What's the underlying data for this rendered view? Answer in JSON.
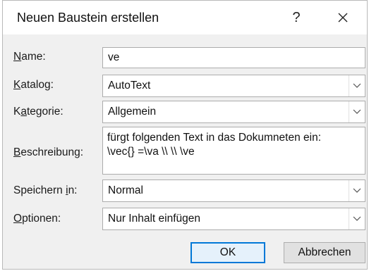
{
  "dialog": {
    "title": "Neuen Baustein erstellen",
    "help_label": "?",
    "close_icon": "close-icon"
  },
  "form": {
    "name": {
      "label_accel": "N",
      "label_rest": "ame:",
      "value": "ve"
    },
    "katalog": {
      "label_accel": "K",
      "label_rest": "atalog:",
      "value": "AutoText"
    },
    "kategorie": {
      "label_pre": "K",
      "label_accel": "a",
      "label_rest": "tegorie:",
      "value": "Allgemein"
    },
    "beschreibung": {
      "label_accel": "B",
      "label_rest": "eschreibung:",
      "line1": "fürgt folgenden Text in das Dokumneten ein:",
      "line2": "\\vec{} =\\va \\\\ \\\\ \\ve"
    },
    "speichern": {
      "label_pre": "Speichern ",
      "label_accel": "i",
      "label_rest": "n:",
      "value": "Normal"
    },
    "optionen": {
      "label_accel": "O",
      "label_rest": "ptionen:",
      "value": "Nur Inhalt einfügen"
    }
  },
  "buttons": {
    "ok": "OK",
    "cancel": "Abbrechen"
  }
}
